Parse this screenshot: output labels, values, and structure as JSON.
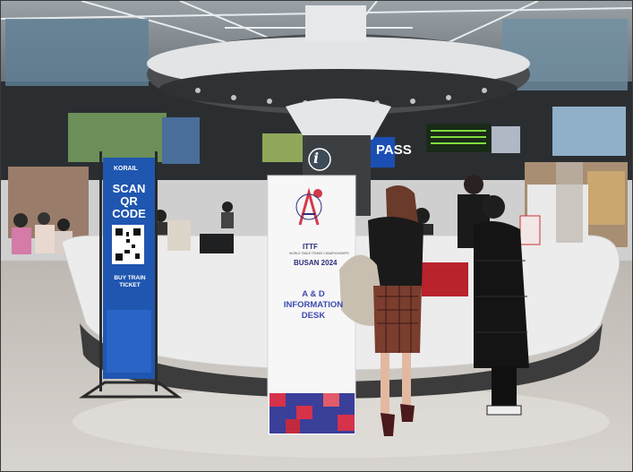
{
  "scene": {
    "left_banner": {
      "brand": "KORAIL",
      "headline": "SCAN QR CODE",
      "cta": "BUY TRAIN TICKET"
    },
    "center_banner": {
      "org": "ITTF",
      "subtitle": "WORLD TABLE TENNIS CHAMPIONSHIPS",
      "event": "BUSAN 2024",
      "desk_title": "A & D INFORMATION DESK"
    },
    "signs": {
      "pass": "PASS"
    },
    "colors": {
      "banner_blue": "#1f56b0",
      "desk_white": "#ececec",
      "desk_base": "#3c3c3c",
      "floor": "#c9c5c0"
    }
  }
}
